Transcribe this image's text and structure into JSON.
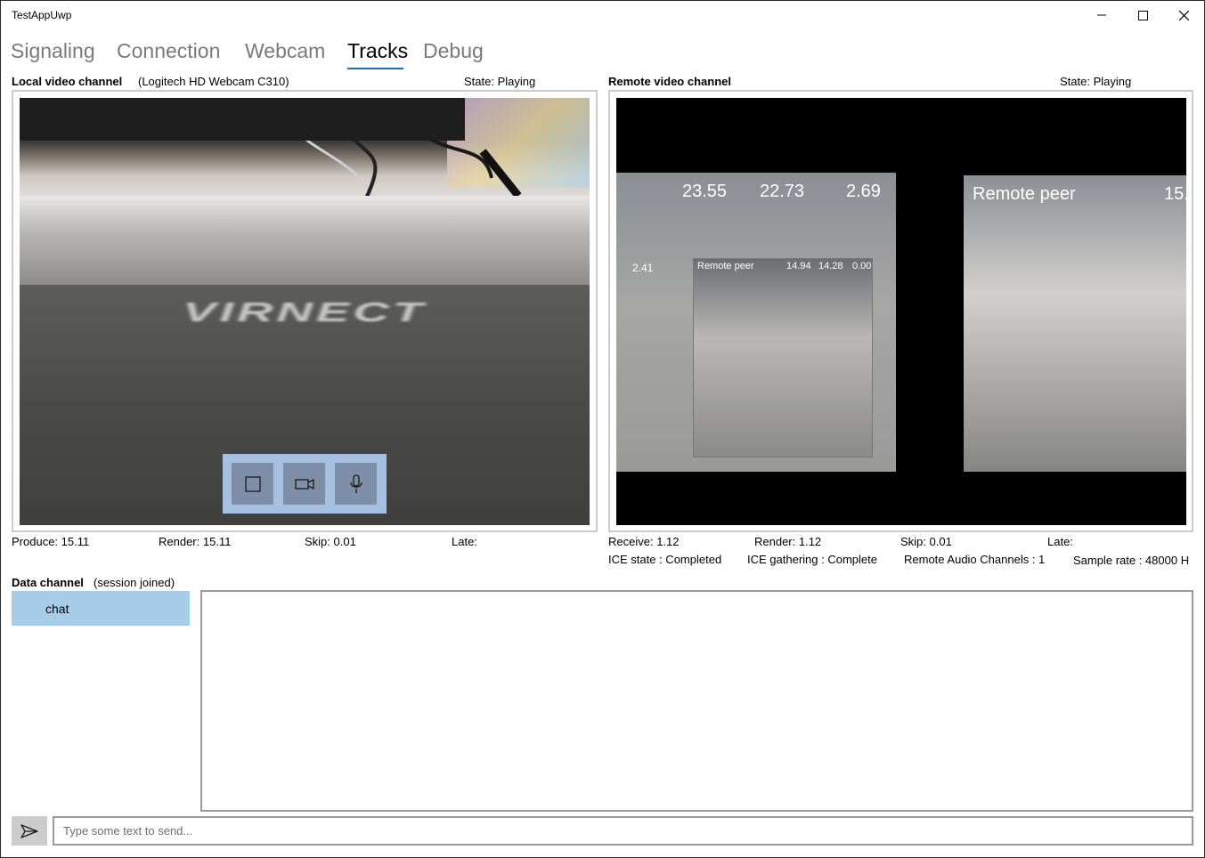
{
  "window": {
    "title": "TestAppUwp"
  },
  "tabs": [
    {
      "label": "Signaling"
    },
    {
      "label": "Connection"
    },
    {
      "label": "Webcam"
    },
    {
      "label": "Tracks"
    },
    {
      "label": "Debug"
    }
  ],
  "active_tab": "Tracks",
  "local": {
    "title": "Local video channel",
    "device": "(Logitech HD Webcam C310)",
    "state": "State: Playing",
    "stats": {
      "produce": "Produce: 15.11",
      "render": "Render: 15.11",
      "skip": "Skip: 0.01",
      "late": "Late:"
    },
    "video_text": "VIRNECT",
    "controls": [
      "stop-icon",
      "camera-icon",
      "microphone-icon"
    ]
  },
  "remote": {
    "title": "Remote video channel",
    "state": "State: Playing",
    "stats": {
      "receive": "Receive: 1.12",
      "render": "Render: 1.12",
      "skip": "Skip: 0.01",
      "late": "Late:"
    },
    "status": {
      "ice_state": "ICE state :  Completed",
      "ice_gathering": "ICE gathering :  Complete",
      "audio_channels": "Remote Audio Channels :  1",
      "sample_rate": "Sample rate :  48000 H"
    },
    "video_overlay": {
      "n1": "23.55",
      "n2": "22.73",
      "n3": "2.69",
      "peer_label": "Remote peer",
      "peer_num": "15.",
      "inner_label": "Remote peer",
      "inner_n1": "14.94",
      "inner_n2": "14.28",
      "inner_n3": "0.00",
      "side_num": "2.41"
    }
  },
  "data_channel": {
    "title": "Data channel",
    "status": "(session joined)",
    "channels": [
      "chat"
    ],
    "input_placeholder": "Type some text to send..."
  },
  "colors": {
    "accent": "#1f6fb8",
    "selected_item": "#a8cde9",
    "control_bar": "#a5c0e0"
  }
}
